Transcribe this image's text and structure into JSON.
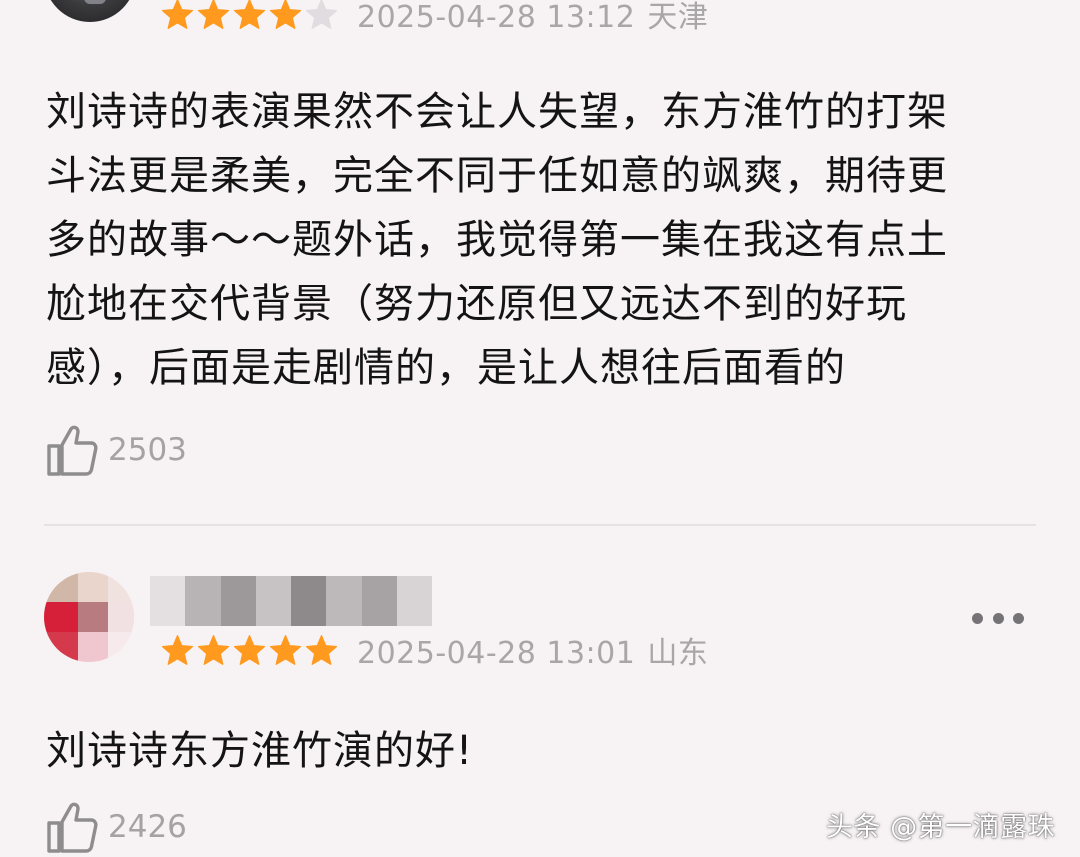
{
  "colors": {
    "star_filled": "#ff9a1f",
    "star_empty": "#e0dcdf",
    "meta_text": "#a9a6a8",
    "background": "#f7f2f4"
  },
  "reviews": [
    {
      "rating": 4,
      "max_rating": 5,
      "timestamp": "2025-04-28 13:12",
      "location": "天津",
      "body": "刘诗诗的表演果然不会让人失望，东方淮竹的打架\n斗法更是柔美，完全不同于任如意的飒爽，期待更\n多的故事～～题外话，我觉得第一集在我这有点土\n尬地在交代背景（努力还原但又远达不到的好玩\n感），后面是走剧情的，是让人想往后面看的",
      "likes": "2503",
      "like_icon": "thumbs-up-icon"
    },
    {
      "rating": 5,
      "max_rating": 5,
      "timestamp": "2025-04-28 13:01",
      "location": "山东",
      "body": "刘诗诗东方淮竹演的好!",
      "likes": "2426",
      "like_icon": "thumbs-up-icon",
      "more_icon": "more-dots-icon"
    }
  ],
  "watermark": "头条 @第一滴露珠"
}
